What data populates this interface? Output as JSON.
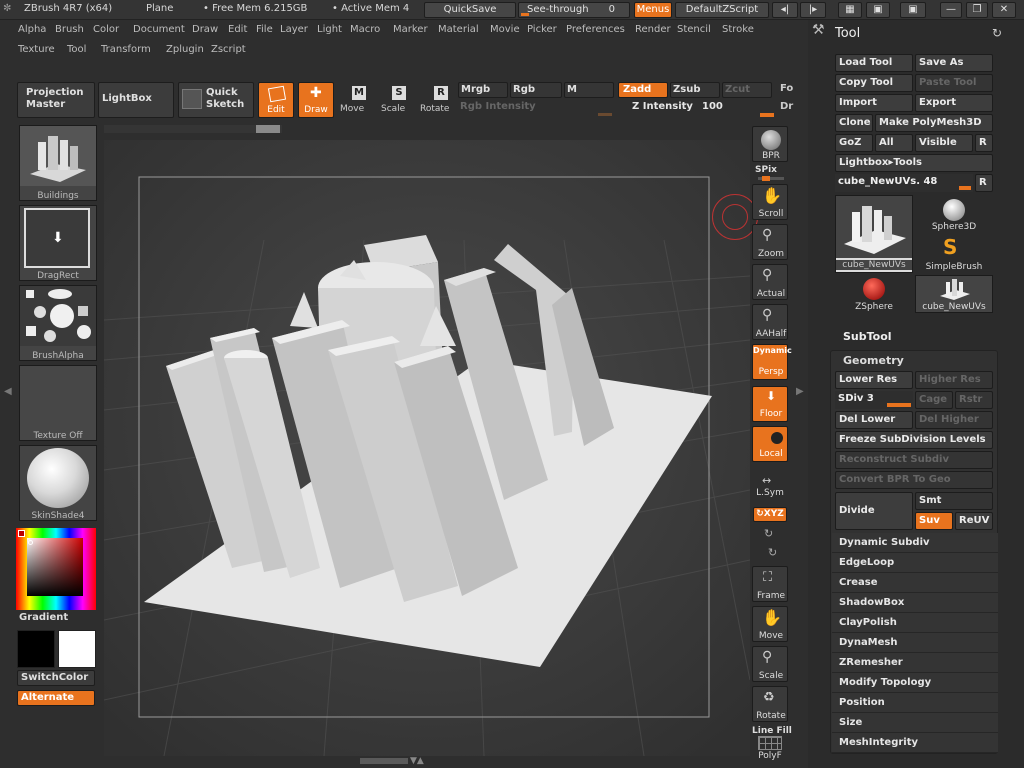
{
  "titlebar": {
    "app": "ZBrush 4R7 (x64)",
    "doc": "Plane",
    "free_mem": "• Free Mem 6.215GB",
    "active_mem": "• Active Mem 4",
    "quicksave": "QuickSave",
    "see_through": "See-through",
    "see_through_value": "0",
    "menus": "Menus",
    "default_zscript": "DefaultZScript"
  },
  "menu_row1": [
    "Alpha",
    "Brush",
    "Color",
    "Document",
    "Draw",
    "Edit",
    "File",
    "Layer",
    "Light",
    "Macro",
    "Marker",
    "Material",
    "Movie",
    "Picker",
    "Preferences",
    "Render",
    "Stencil",
    "Stroke"
  ],
  "menu_row2": [
    "Texture",
    "Tool",
    "Transform",
    "Zplugin",
    "Zscript"
  ],
  "top_shelf": {
    "projection_master": "Projection Master",
    "lightbox": "LightBox",
    "quick_sketch": "Quick Sketch",
    "edit": "Edit",
    "draw": "Draw",
    "move": "Move",
    "scale": "Scale",
    "rotate": "Rotate",
    "mrgb": "Mrgb",
    "rgb": "Rgb",
    "m": "M",
    "zadd": "Zadd",
    "zsub": "Zsub",
    "zcut": "Zcut",
    "fo": "Fo",
    "rgb_intensity": "Rgb Intensity",
    "z_intensity": "Z Intensity",
    "z_intensity_value": "100",
    "dr": "Dr"
  },
  "left_tray": {
    "buildings": "Buildings",
    "dragrect": "DragRect",
    "brushalpha": "BrushAlpha",
    "texture_off": "Texture Off",
    "skinshade4": "SkinShade4",
    "gradient": "Gradient",
    "switchcolor": "SwitchColor",
    "alternate": "Alternate"
  },
  "right_shelf": {
    "bpr": "BPR",
    "spix": "SPix",
    "scroll": "Scroll",
    "zoom": "Zoom",
    "actual": "Actual",
    "aahalf": "AAHalf",
    "dynamic": "Dynamic",
    "persp": "Persp",
    "floor": "Floor",
    "local": "Local",
    "lsym": "L.Sym",
    "xyz": "XYZ",
    "frame": "Frame",
    "move": "Move",
    "scale": "Scale",
    "rotate": "Rotate",
    "line_fill": "Line Fill",
    "polyf": "PolyF"
  },
  "tool": {
    "title": "Tool",
    "load_tool": "Load Tool",
    "save_as": "Save As",
    "copy_tool": "Copy Tool",
    "paste_tool": "Paste Tool",
    "import": "Import",
    "export": "Export",
    "clone": "Clone",
    "make_polymesh": "Make PolyMesh3D",
    "goz": "GoZ",
    "all": "All",
    "visible": "Visible",
    "r": "R",
    "lightbox_tools": "Lightbox▸Tools",
    "current_tool": "cube_NewUVs. 48",
    "thumbs": {
      "cube": "cube_NewUVs",
      "sphere3d": "Sphere3D",
      "simplebrush": "SimpleBrush",
      "zsphere": "ZSphere",
      "cube2": "cube_NewUVs"
    },
    "subtool": "SubTool",
    "geometry": "Geometry",
    "lower_res": "Lower Res",
    "higher_res": "Higher Res",
    "sdiv": "SDiv 3",
    "cage": "Cage",
    "rstr": "Rstr",
    "del_lower": "Del Lower",
    "del_higher": "Del Higher",
    "freeze": "Freeze SubDivision Levels",
    "reconstruct": "Reconstruct Subdiv",
    "convert_bpr": "Convert BPR To Geo",
    "divide": "Divide",
    "smt": "Smt",
    "suv": "Suv",
    "reuv": "ReUV",
    "sections": [
      "Dynamic Subdiv",
      "EdgeLoop",
      "Crease",
      "ShadowBox",
      "ClayPolish",
      "DynaMesh",
      "ZRemesher",
      "Modify Topology",
      "Position",
      "Size",
      "MeshIntegrity"
    ]
  },
  "colors": {
    "accent": "#e8731e",
    "background": "#2e2e2e",
    "canvas": "#3a3a3a"
  }
}
